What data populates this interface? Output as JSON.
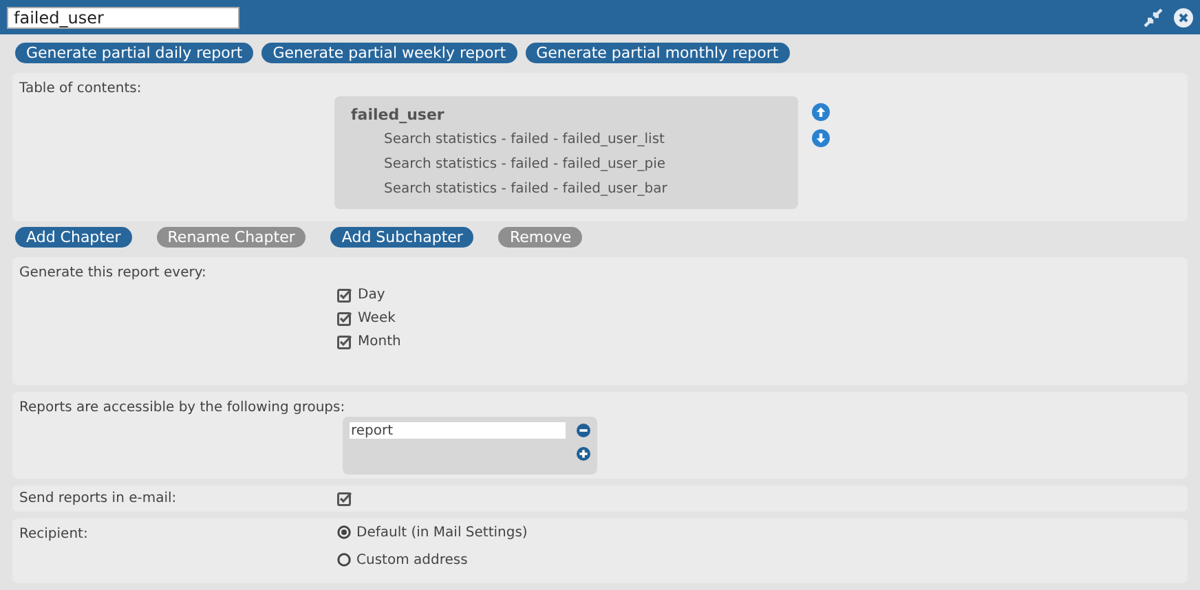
{
  "window": {
    "title": "failed_user"
  },
  "report_buttons": [
    {
      "label": "Generate partial daily report"
    },
    {
      "label": "Generate partial weekly report"
    },
    {
      "label": "Generate partial monthly report"
    }
  ],
  "toc": {
    "label": "Table of contents:",
    "chapter": "failed_user",
    "children": [
      {
        "label": "Search statistics - failed - failed_user_list"
      },
      {
        "label": "Search statistics - failed - failed_user_pie"
      },
      {
        "label": "Search statistics - failed - failed_user_bar"
      }
    ]
  },
  "chapter_buttons": [
    {
      "label": "Add Chapter",
      "disabled": false
    },
    {
      "label": "Rename Chapter",
      "disabled": true
    },
    {
      "label": "Add Subchapter",
      "disabled": false
    },
    {
      "label": "Remove",
      "disabled": true
    }
  ],
  "schedule": {
    "label": "Generate this report every:",
    "options": [
      {
        "label": "Day",
        "checked": true
      },
      {
        "label": "Week",
        "checked": true
      },
      {
        "label": "Month",
        "checked": true
      }
    ]
  },
  "groups": {
    "label": "Reports are accessible by the following groups:",
    "items": [
      {
        "value": "report"
      }
    ]
  },
  "email": {
    "label": "Send reports in e-mail:",
    "checked": true
  },
  "recipient": {
    "label": "Recipient:",
    "options": [
      {
        "label": "Default (in Mail Settings)",
        "selected": true
      },
      {
        "label": "Custom address",
        "selected": false
      }
    ]
  }
}
